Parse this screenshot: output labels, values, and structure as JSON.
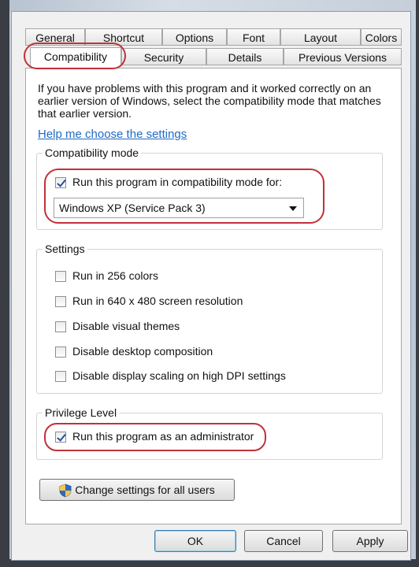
{
  "tabs_row1": [
    "General",
    "Shortcut",
    "Options",
    "Font",
    "Layout",
    "Colors"
  ],
  "tabs_row2": [
    "Compatibility",
    "Security",
    "Details",
    "Previous Versions"
  ],
  "intro_text": "If you have problems with this program and it worked correctly on an earlier version of Windows, select the compatibility mode that matches that earlier version.",
  "help_link": "Help me choose the settings",
  "compat_mode": {
    "label": "Compatibility mode",
    "checkbox_label": "Run this program in compatibility mode for:",
    "checked": true,
    "selected_value": "Windows XP (Service Pack 3)"
  },
  "settings": {
    "label": "Settings",
    "items": [
      {
        "label": "Run in 256 colors",
        "checked": false
      },
      {
        "label": "Run in 640 x 480 screen resolution",
        "checked": false
      },
      {
        "label": "Disable visual themes",
        "checked": false
      },
      {
        "label": "Disable desktop composition",
        "checked": false
      },
      {
        "label": "Disable display scaling on high DPI settings",
        "checked": false
      }
    ]
  },
  "privilege": {
    "label": "Privilege Level",
    "checkbox_label": "Run this program as an administrator",
    "checked": true
  },
  "change_all_button": "Change settings for all users",
  "buttons": {
    "ok": "OK",
    "cancel": "Cancel",
    "apply": "Apply"
  },
  "colors": {
    "annotation": "#c0313a",
    "link": "#1e6ac8",
    "checkmark": "#2a4f9e"
  }
}
